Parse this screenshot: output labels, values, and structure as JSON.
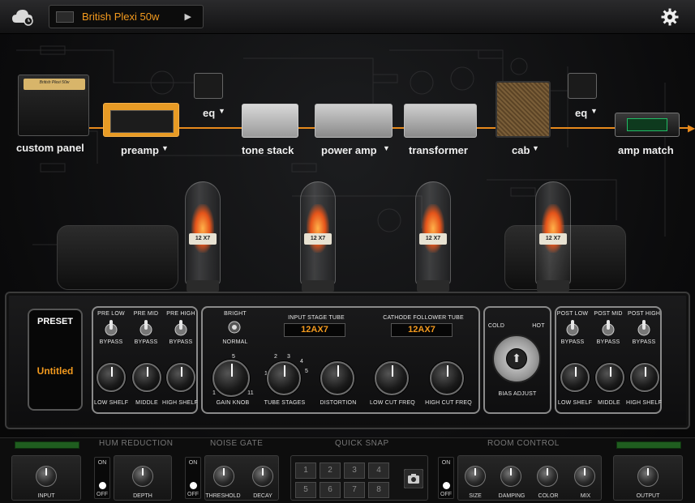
{
  "topbar": {
    "preset_name": "British Plexi 50w",
    "arrow": "▶"
  },
  "chain": {
    "custom_panel": "custom panel",
    "preamp": "preamp",
    "eq1": "eq",
    "tone_stack": "tone stack",
    "power_amp": "power amp",
    "transformer": "transformer",
    "cab": "cab",
    "eq2": "eq",
    "amp_match": "amp match",
    "preamp_thumb_text": "British Plexi 50w"
  },
  "tubes": [
    {
      "tag": "12 X7"
    },
    {
      "tag": "12 X7"
    },
    {
      "tag": "12 X7"
    },
    {
      "tag": "12 X7"
    }
  ],
  "panel": {
    "preset_title": "PRESET",
    "preset_value": "Untitled",
    "pre_low": "PRE LOW",
    "pre_mid": "PRE MID",
    "pre_high": "PRE HIGH",
    "bypass": "BYPASS",
    "low_shelf": "LOW SHELF",
    "middle": "MIDDLE",
    "high_shelf": "HIGH SHELF",
    "bright": "BRIGHT",
    "normal": "NORMAL",
    "input_stage_tube": "INPUT STAGE TUBE",
    "input_stage_value": "12AX7",
    "cathode_follower_tube": "CATHODE FOLLOWER TUBE",
    "cathode_value": "12AX7",
    "gain_knob": "GAIN KNOB",
    "tube_stages": "TUBE STAGES",
    "distortion": "DISTORTION",
    "low_cut_freq": "LOW CUT FREQ",
    "high_cut_freq": "HIGH CUT FREQ",
    "cold": "COLD",
    "hot": "HOT",
    "bias_adjust": "BIAS ADJUST",
    "post_low": "POST LOW",
    "post_mid": "POST MID",
    "post_high": "POST HIGH",
    "gain_scale": [
      "1",
      "5",
      "11"
    ],
    "stage_scale": [
      "1",
      "2",
      "3",
      "4",
      "5"
    ]
  },
  "strip": {
    "hum_reduction": "HUM REDUCTION",
    "noise_gate": "NOISE GATE",
    "quick_snap": "QUICK SNAP",
    "room_control": "ROOM CONTROL",
    "input": "INPUT",
    "on": "ON",
    "off": "OFF",
    "depth": "DEPTH",
    "threshold": "THRESHOLD",
    "decay": "DECAY",
    "snaps": [
      "1",
      "2",
      "3",
      "4",
      "5",
      "6",
      "7",
      "8"
    ],
    "size": "SIZE",
    "damping": "DAMPING",
    "color": "COLOR",
    "mix": "MIX",
    "output": "OUTPUT"
  },
  "colors": {
    "accent": "#f39a1e",
    "chain": "#e88a1c",
    "led": "#1f5d1f"
  }
}
